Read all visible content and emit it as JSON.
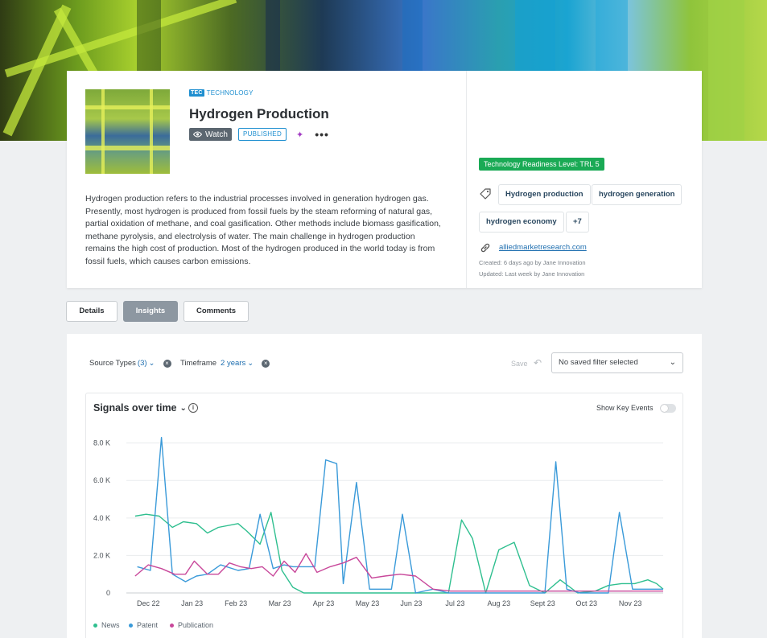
{
  "topic": {
    "category_badge": "TEC",
    "category_label": "TECHNOLOGY",
    "title": "Hydrogen Production",
    "watch_label": "Watch",
    "status": "PUBLISHED",
    "more_label": "•••",
    "description": "Hydrogen production refers to the industrial processes involved in generation hydrogen gas. Presently, most hydrogen is produced from fossil fuels by the steam reforming of natural gas, partial oxidation of methane, and coal gasification. Other methods include biomass gasification, methane pyrolysis, and electrolysis of water. The main challenge in hydrogen production remains the high cost of production. Most of the hydrogen produced in the world today is from fossil fuels, which causes carbon emissions."
  },
  "sidebar": {
    "trl_label": "Technology Readiness Level: TRL 5",
    "tags": [
      "Hydrogen production",
      "hydrogen generation",
      "hydrogen economy",
      "+7"
    ],
    "source_link": "alliedmarketresearch.com",
    "created": "Created: 6 days ago by Jane Innovation",
    "updated": "Updated: Last week by Jane Innovation"
  },
  "tabs": [
    {
      "label": "Details",
      "active": false
    },
    {
      "label": "Insights",
      "active": true
    },
    {
      "label": "Comments",
      "active": false
    }
  ],
  "filters": {
    "source_types_label": "Source Types",
    "source_types_value": "(3)",
    "timeframe_label": "Timeframe",
    "timeframe_value": "2 years",
    "save_label": "Save",
    "saved_filter_placeholder": "No saved filter selected"
  },
  "chart": {
    "title": "Signals over time",
    "key_events_label": "Show Key Events"
  },
  "colors": {
    "news": "#2fbf8f",
    "patent": "#3a9ad9",
    "publication": "#c8479a",
    "trl": "#1aaa55",
    "accent": "#1f8fd0"
  },
  "chart_data": {
    "type": "line",
    "title": "Signals over time",
    "x_tick_labels": [
      "Dec 22",
      "Jan 23",
      "Feb 23",
      "Mar 23",
      "Apr 23",
      "May 23",
      "Jun 23",
      "Jul 23",
      "Aug 23",
      "Sept 23",
      "Oct 23",
      "Nov 23"
    ],
    "y_tick_labels": [
      "0",
      "2.0 K",
      "4.0 K",
      "6.0 K",
      "8.0 K"
    ],
    "ylim": [
      0,
      8500
    ],
    "x_range_months": [
      -0.5,
      11.75
    ],
    "grid": true,
    "legend_position": "bottom-left",
    "series": [
      {
        "name": "News",
        "x": [
          -0.3,
          -0.05,
          0.25,
          0.55,
          0.8,
          1.1,
          1.35,
          1.6,
          2.05,
          2.25,
          2.55,
          2.8,
          3.05,
          3.3,
          3.55,
          3.85,
          4.15,
          4.4,
          4.7,
          5.05,
          5.4,
          5.75,
          6.1,
          6.5,
          6.85,
          7.15,
          7.4,
          7.7,
          8.0,
          8.35,
          8.7,
          9.05,
          9.4,
          9.8,
          10.2,
          10.5,
          10.8,
          11.1,
          11.4,
          11.6,
          11.75
        ],
        "y": [
          4100,
          4200,
          4100,
          3500,
          3800,
          3700,
          3200,
          3500,
          3700,
          3300,
          2600,
          4300,
          1200,
          300,
          0,
          0,
          0,
          0,
          0,
          0,
          0,
          0,
          0,
          0,
          0,
          3900,
          2900,
          0,
          2300,
          2700,
          400,
          0,
          700,
          0,
          100,
          400,
          500,
          500,
          700,
          500,
          200
        ]
      },
      {
        "name": "Patent",
        "x": [
          -0.25,
          0.05,
          0.3,
          0.55,
          0.85,
          1.1,
          1.35,
          1.65,
          2.05,
          2.3,
          2.55,
          2.85,
          3.1,
          3.3,
          3.55,
          3.8,
          4.05,
          4.3,
          4.45,
          4.75,
          5.05,
          5.3,
          5.55,
          5.8,
          6.1,
          6.5,
          6.85,
          7.15,
          7.5,
          7.8,
          8.1,
          8.4,
          8.7,
          9.05,
          9.3,
          9.55,
          9.85,
          10.2,
          10.5,
          10.75,
          11.05,
          11.4,
          11.75
        ],
        "y": [
          1400,
          1200,
          8300,
          1000,
          600,
          900,
          1000,
          1500,
          1200,
          1300,
          4200,
          1300,
          1500,
          1400,
          1400,
          1400,
          7100,
          6900,
          500,
          5900,
          200,
          200,
          200,
          4200,
          0,
          200,
          0,
          0,
          0,
          0,
          0,
          0,
          0,
          0,
          7000,
          200,
          0,
          0,
          0,
          4300,
          200,
          200,
          200
        ]
      },
      {
        "name": "Publication",
        "x": [
          -0.3,
          0.0,
          0.3,
          0.6,
          0.85,
          1.05,
          1.35,
          1.6,
          1.85,
          2.1,
          2.35,
          2.6,
          2.85,
          3.1,
          3.35,
          3.6,
          3.85,
          4.15,
          4.45,
          4.75,
          5.1,
          5.4,
          5.75,
          6.1,
          6.5,
          6.9,
          7.3,
          7.7,
          8.1,
          8.5,
          8.9,
          9.3,
          9.7,
          10.1,
          10.5,
          10.9,
          11.3,
          11.75
        ],
        "y": [
          900,
          1500,
          1300,
          1000,
          1000,
          1700,
          1000,
          1000,
          1600,
          1400,
          1300,
          1400,
          900,
          1700,
          1100,
          2100,
          1100,
          1400,
          1600,
          1900,
          800,
          900,
          1000,
          900,
          200,
          100,
          100,
          100,
          100,
          100,
          100,
          100,
          100,
          100,
          100,
          100,
          100,
          100
        ]
      }
    ]
  }
}
